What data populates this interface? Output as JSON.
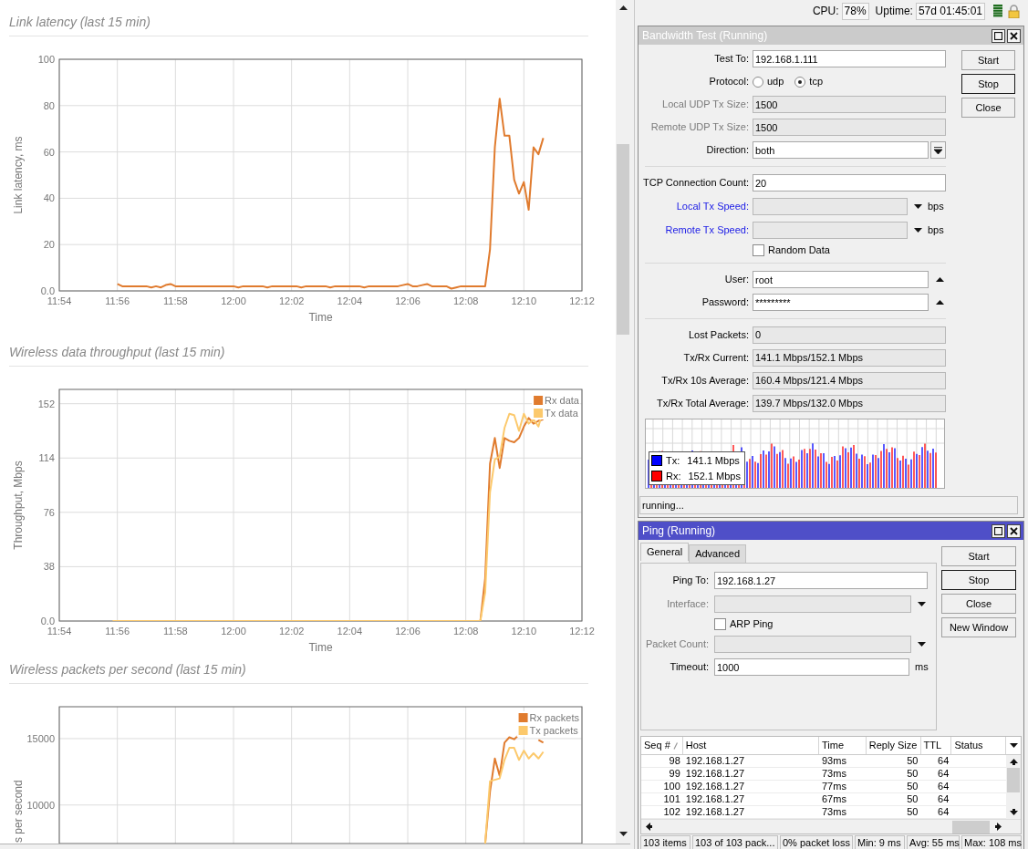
{
  "charts_pane": {
    "sections": [
      {
        "title": "Link latency (last 15 min)",
        "chart_data": {
          "type": "line",
          "xlabel": "Time",
          "ylabel": "Link latency, ms",
          "categories": [
            "11:54",
            null,
            null,
            null,
            null,
            null,
            null,
            null,
            null,
            null,
            null,
            null,
            "11:56",
            null,
            null,
            null,
            null,
            null,
            null,
            null,
            null,
            null,
            null,
            null,
            "11:58",
            null,
            null,
            null,
            null,
            null,
            null,
            null,
            null,
            null,
            null,
            null,
            "12:00",
            null,
            null,
            null,
            null,
            null,
            null,
            null,
            null,
            null,
            null,
            null,
            "12:02",
            null,
            null,
            null,
            null,
            null,
            null,
            null,
            null,
            null,
            null,
            null,
            "12:04",
            null,
            null,
            null,
            null,
            null,
            null,
            null,
            null,
            null,
            null,
            null,
            "12:06",
            null,
            null,
            null,
            null,
            null,
            null,
            null,
            null,
            null,
            null,
            null,
            "12:08",
            null,
            null,
            null,
            null,
            null,
            null,
            null,
            null,
            null,
            null,
            null,
            "12:10",
            null,
            null,
            null,
            null,
            null,
            null,
            null,
            null,
            null,
            null,
            null,
            "12:12"
          ],
          "series": [
            {
              "color": "#e07b2e",
              "values": [
                null,
                null,
                null,
                null,
                null,
                null,
                null,
                null,
                null,
                null,
                null,
                null,
                3,
                2,
                2,
                2,
                2,
                2,
                2,
                1.5,
                2,
                1.5,
                2.5,
                3,
                2,
                2,
                2,
                2,
                2,
                2,
                2,
                2,
                2,
                2,
                2,
                2,
                2,
                1.5,
                2,
                2,
                2,
                2,
                2,
                1.5,
                2,
                2,
                2,
                2,
                2,
                2,
                1.5,
                2,
                2,
                2,
                2,
                2,
                1.5,
                2,
                2,
                2,
                2,
                2,
                2,
                1.5,
                2,
                2,
                2,
                2,
                2,
                2,
                2,
                2.5,
                3,
                2,
                2,
                2.5,
                3,
                2,
                2,
                2,
                2,
                1,
                1.5,
                2,
                2,
                2,
                2,
                2,
                2,
                18,
                62,
                83,
                67,
                67,
                48,
                42,
                47,
                35,
                62,
                59,
                66,
                null,
                null,
                null,
                null,
                null,
                null,
                null,
                null
              ]
            }
          ],
          "ylim": [
            0,
            100
          ],
          "grid": true,
          "yticks": [
            {
              "value": 0,
              "label": "0.0"
            },
            20,
            40,
            60,
            80,
            100
          ]
        }
      },
      {
        "title": "Wireless data throughput (last 15 min)",
        "chart_data": {
          "type": "line",
          "xlabel": "Time",
          "ylabel": "Throughput, Mbps",
          "categories": [
            "11:54",
            null,
            null,
            null,
            null,
            null,
            null,
            null,
            null,
            null,
            null,
            null,
            "11:56",
            null,
            null,
            null,
            null,
            null,
            null,
            null,
            null,
            null,
            null,
            null,
            "11:58",
            null,
            null,
            null,
            null,
            null,
            null,
            null,
            null,
            null,
            null,
            null,
            "12:00",
            null,
            null,
            null,
            null,
            null,
            null,
            null,
            null,
            null,
            null,
            null,
            "12:02",
            null,
            null,
            null,
            null,
            null,
            null,
            null,
            null,
            null,
            null,
            null,
            "12:04",
            null,
            null,
            null,
            null,
            null,
            null,
            null,
            null,
            null,
            null,
            null,
            "12:06",
            null,
            null,
            null,
            null,
            null,
            null,
            null,
            null,
            null,
            null,
            null,
            "12:08",
            null,
            null,
            null,
            null,
            null,
            null,
            null,
            null,
            null,
            null,
            null,
            "12:10",
            null,
            null,
            null,
            null,
            null,
            null,
            null,
            null,
            null,
            null,
            null,
            "12:12"
          ],
          "series": [
            {
              "name": "Rx data",
              "color": "#e07b2e",
              "values": [
                null,
                null,
                null,
                null,
                null,
                null,
                null,
                null,
                null,
                null,
                null,
                null,
                null,
                null,
                null,
                null,
                null,
                null,
                null,
                null,
                null,
                null,
                null,
                null,
                null,
                null,
                null,
                null,
                null,
                null,
                null,
                null,
                null,
                null,
                null,
                null,
                null,
                null,
                null,
                null,
                null,
                null,
                null,
                null,
                null,
                null,
                null,
                null,
                null,
                null,
                null,
                null,
                null,
                null,
                null,
                null,
                null,
                null,
                null,
                null,
                null,
                null,
                null,
                null,
                null,
                null,
                null,
                null,
                null,
                null,
                null,
                null,
                null,
                null,
                null,
                null,
                null,
                null,
                null,
                null,
                null,
                null,
                null,
                null,
                null,
                null,
                null,
                0,
                30,
                110,
                128,
                107,
                128,
                126,
                125,
                128,
                136,
                142,
                138,
                140,
                141,
                null,
                null,
                null,
                null,
                null,
                null,
                null,
                null
              ]
            },
            {
              "name": "Tx data",
              "color": "#fcc96c",
              "values": [
                null,
                null,
                null,
                null,
                null,
                null,
                null,
                null,
                null,
                null,
                null,
                0,
                0,
                0,
                0,
                0,
                0,
                0,
                0,
                0,
                0,
                0,
                0,
                0,
                0,
                0,
                0,
                0,
                0,
                0,
                0,
                0,
                0,
                0,
                0,
                0,
                0,
                0,
                0,
                0,
                0,
                0,
                0,
                0,
                0,
                0,
                0,
                0,
                0,
                0,
                0,
                0,
                0,
                0,
                0,
                0,
                0,
                0,
                0,
                0,
                0,
                0,
                0,
                0,
                0,
                0,
                0,
                0,
                0,
                0,
                0,
                0,
                0,
                0,
                0,
                0,
                0,
                0,
                0,
                0,
                0,
                0,
                0,
                0,
                0,
                0,
                0,
                0,
                20,
                90,
                113,
                115,
                135,
                145,
                144,
                133,
                145,
                138,
                141,
                136,
                148,
                null,
                null,
                null,
                null,
                null,
                null,
                null,
                null
              ]
            }
          ],
          "ylim": [
            0,
            162
          ],
          "grid": true,
          "legend": true,
          "yticks": [
            {
              "value": 0,
              "label": "0.0"
            },
            38,
            76,
            114,
            152
          ]
        }
      },
      {
        "title": "Wireless packets per second (last 15 min)",
        "chart_data": {
          "type": "line",
          "ylabel": "s per second",
          "categories": [
            null,
            null,
            null,
            null,
            null,
            null,
            null,
            null,
            null,
            null,
            null,
            null,
            null,
            null,
            null,
            null,
            null,
            null,
            null,
            null,
            null,
            null,
            null,
            null,
            null,
            null,
            null,
            null,
            null,
            null,
            null,
            null,
            null,
            null,
            null,
            null,
            null,
            null,
            null,
            null,
            null,
            null,
            null,
            null,
            null,
            null,
            null,
            null,
            null,
            null,
            null,
            null,
            null,
            null,
            null,
            null,
            null,
            null,
            null,
            null,
            null,
            null,
            null,
            null,
            null,
            null,
            null,
            null,
            null,
            null,
            null,
            null,
            null,
            null,
            null,
            null,
            null,
            null,
            null,
            null,
            null,
            null,
            null,
            null,
            null,
            null,
            null,
            null,
            null,
            null,
            null,
            null,
            null,
            null,
            null,
            null,
            null,
            null,
            null,
            null,
            null,
            null,
            null,
            null,
            null,
            null,
            null,
            null,
            null
          ],
          "series": [
            {
              "name": "Rx packets",
              "color": "#e07b2e",
              "values": [
                null,
                null,
                null,
                null,
                null,
                null,
                null,
                null,
                null,
                null,
                null,
                null,
                null,
                null,
                null,
                null,
                null,
                null,
                null,
                null,
                null,
                null,
                null,
                null,
                null,
                null,
                null,
                null,
                null,
                null,
                null,
                null,
                null,
                null,
                null,
                null,
                null,
                null,
                null,
                null,
                null,
                null,
                null,
                null,
                null,
                null,
                null,
                null,
                null,
                null,
                null,
                null,
                null,
                null,
                null,
                null,
                null,
                null,
                null,
                null,
                null,
                null,
                null,
                null,
                null,
                null,
                null,
                null,
                null,
                null,
                null,
                null,
                null,
                null,
                null,
                null,
                null,
                null,
                null,
                null,
                null,
                null,
                null,
                null,
                null,
                null,
                null,
                null,
                7100,
                11000,
                13500,
                12200,
                14700,
                15100,
                14950,
                15300,
                null,
                null,
                null,
                14900,
                14700,
                null,
                null,
                null,
                null,
                null,
                null,
                null,
                null
              ]
            },
            {
              "name": "Tx packets",
              "color": "#fcc96c",
              "values": [
                null,
                null,
                null,
                null,
                null,
                null,
                null,
                null,
                null,
                null,
                null,
                null,
                null,
                null,
                null,
                null,
                null,
                null,
                null,
                null,
                null,
                null,
                null,
                null,
                null,
                null,
                null,
                null,
                null,
                null,
                null,
                null,
                null,
                null,
                null,
                null,
                null,
                null,
                null,
                null,
                null,
                null,
                null,
                null,
                null,
                null,
                null,
                null,
                null,
                null,
                null,
                null,
                null,
                null,
                null,
                null,
                null,
                null,
                null,
                null,
                null,
                null,
                null,
                null,
                null,
                null,
                null,
                null,
                null,
                null,
                null,
                null,
                null,
                null,
                null,
                null,
                null,
                null,
                null,
                null,
                null,
                null,
                null,
                null,
                null,
                null,
                null,
                null,
                7100,
                11800,
                11900,
                12000,
                13400,
                14300,
                14300,
                13400,
                14100,
                13500,
                13900,
                13500,
                14000,
                null,
                null,
                null,
                null,
                null,
                null,
                null,
                null
              ]
            }
          ],
          "ylim": [
            7100,
            17400
          ],
          "grid": true,
          "legend": true,
          "yticks": [
            {
              "value": 10000,
              "label": "10000"
            },
            {
              "value": 15000,
              "label": "15000"
            }
          ]
        }
      }
    ]
  },
  "status": {
    "cpu_label": "CPU:",
    "cpu": "78%",
    "uptime_label": "Uptime:",
    "uptime": "57d 01:45:01"
  },
  "bandwidth_test": {
    "title": "Bandwidth Test (Running)",
    "active": false,
    "fields": [
      {
        "kind": "text",
        "label": "Test To:",
        "value": "192.168.1.111",
        "disabled": false,
        "link": false
      },
      {
        "kind": "radio",
        "label": "Protocol:",
        "link": false,
        "options": [
          {
            "label": "udp",
            "selected": false
          },
          {
            "label": "tcp",
            "selected": true
          }
        ]
      },
      {
        "kind": "text",
        "label": "Local UDP Tx Size:",
        "value": "1500",
        "disabled": true,
        "link": false
      },
      {
        "kind": "text",
        "label": "Remote UDP Tx Size:",
        "value": "1500",
        "disabled": true,
        "link": false
      },
      {
        "kind": "select",
        "label": "Direction:",
        "value": "both",
        "disabled": false,
        "link": false
      },
      {
        "kind": "separator"
      },
      {
        "kind": "text",
        "label": "TCP Connection Count:",
        "value": "20",
        "disabled": false,
        "link": false
      },
      {
        "kind": "combo",
        "label": "Local Tx Speed:",
        "unit": "bps",
        "disabled": true,
        "link": true
      },
      {
        "kind": "combo",
        "label": "Remote Tx Speed:",
        "unit": "bps",
        "disabled": true,
        "link": true
      },
      {
        "kind": "checkbox",
        "label": "Random Data",
        "checked": false
      },
      {
        "kind": "separator"
      },
      {
        "kind": "updown",
        "label": "User:",
        "value": "root",
        "disabled": false,
        "link": false
      },
      {
        "kind": "updown",
        "label": "Password:",
        "value": "*********",
        "disabled": false,
        "link": false
      },
      {
        "kind": "separator"
      },
      {
        "kind": "readonly",
        "label": "Lost Packets:",
        "value": "0",
        "link": false
      },
      {
        "kind": "readonly",
        "label": "Tx/Rx Current:",
        "value": "141.1 Mbps/152.1 Mbps",
        "link": false
      },
      {
        "kind": "readonly",
        "label": "Tx/Rx 10s Average:",
        "value": "160.4 Mbps/121.4 Mbps",
        "link": false
      },
      {
        "kind": "readonly",
        "label": "Tx/Rx Total Average:",
        "value": "139.7 Mbps/132.0 Mbps",
        "link": false
      }
    ],
    "graph": {
      "legend": [
        {
          "label": "Tx:",
          "value": "141.1 Mbps",
          "color": "#0000ff"
        },
        {
          "label": "Rx:",
          "value": "152.1 Mbps",
          "color": "#ff0000"
        }
      ]
    },
    "buttons": [
      {
        "label": "Start",
        "default": false
      },
      {
        "label": "Stop",
        "default": true
      },
      {
        "label": "Close",
        "default": false
      }
    ],
    "status": "running..."
  },
  "ping": {
    "title": "Ping (Running)",
    "active": true,
    "tabs": [
      {
        "label": "General",
        "selected": true
      },
      {
        "label": "Advanced",
        "selected": false
      }
    ],
    "fields": [
      {
        "kind": "text",
        "label": "Ping To:",
        "value": "192.168.1.27",
        "disabled": false,
        "link": false
      },
      {
        "kind": "combo",
        "label": "Interface:",
        "disabled": true,
        "link": false
      },
      {
        "kind": "checkbox",
        "label": "ARP Ping",
        "checked": false
      },
      {
        "kind": "combo",
        "label": "Packet Count:",
        "disabled": true,
        "link": false
      },
      {
        "kind": "unit",
        "label": "Timeout:",
        "value": "1000",
        "unit": "ms",
        "disabled": false,
        "link": false
      }
    ],
    "buttons": [
      {
        "label": "Start",
        "default": false
      },
      {
        "label": "Stop",
        "default": true
      },
      {
        "label": "Close",
        "default": false
      },
      {
        "label": "New Window",
        "default": false
      }
    ],
    "table": {
      "columns": [
        {
          "label": "Seq #",
          "sorted": true
        },
        {
          "label": "Host",
          "sorted": false
        },
        {
          "label": "Time",
          "sorted": false
        },
        {
          "label": "Reply Size",
          "sorted": false
        },
        {
          "label": "TTL",
          "sorted": false
        },
        {
          "label": "Status",
          "sorted": false
        }
      ],
      "rows": [
        {
          "cells": [
            "98",
            "192.168.1.27",
            "93ms",
            "50",
            "64"
          ]
        },
        {
          "cells": [
            "99",
            "192.168.1.27",
            "73ms",
            "50",
            "64"
          ]
        },
        {
          "cells": [
            "100",
            "192.168.1.27",
            "77ms",
            "50",
            "64"
          ]
        },
        {
          "cells": [
            "101",
            "192.168.1.27",
            "67ms",
            "50",
            "64"
          ]
        },
        {
          "cells": [
            "102",
            "192.168.1.27",
            "73ms",
            "50",
            "64"
          ]
        }
      ]
    },
    "status_bar": [
      "103 items",
      "103 of 103 pack...",
      "0% packet loss",
      "Min: 9 ms",
      "Avg: 55 ms",
      "Max: 108 ms"
    ]
  }
}
